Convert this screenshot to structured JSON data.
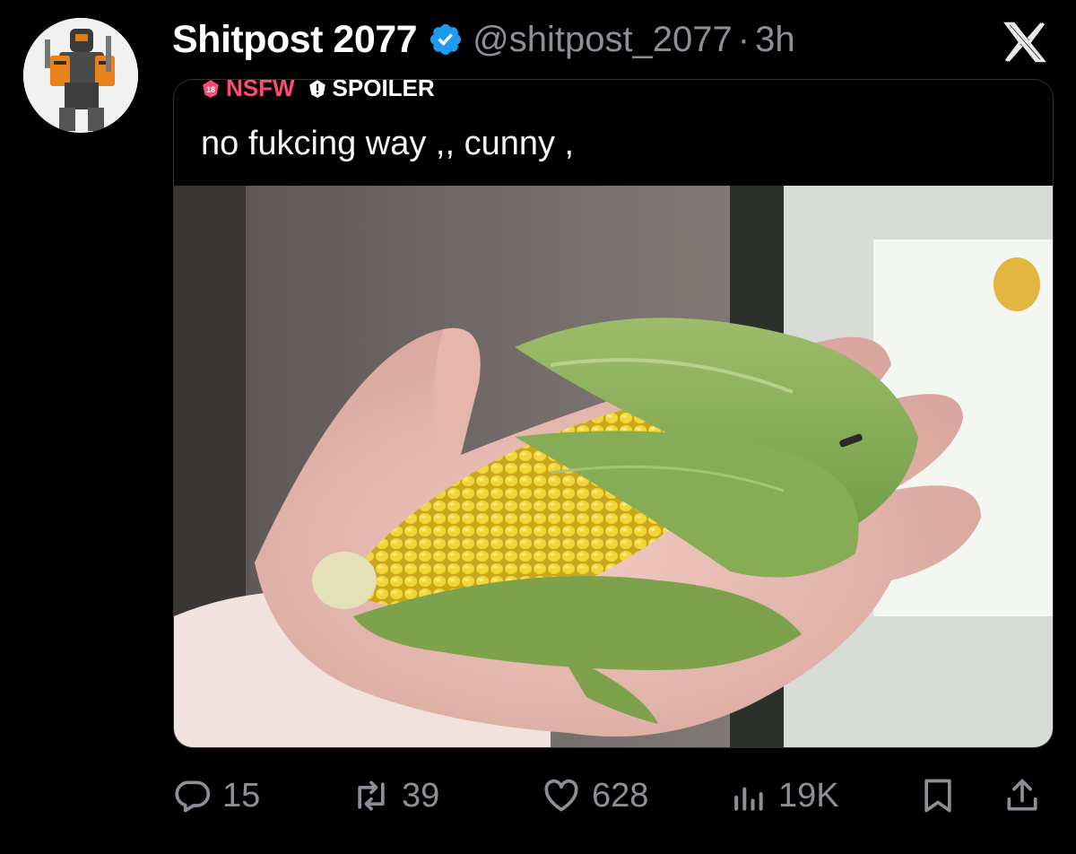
{
  "post": {
    "display_name": "Shitpost 2077",
    "handle": "@shitpost_2077",
    "separator": "·",
    "time": "3h",
    "verified_icon": "verified-badge-icon",
    "brand_icon": "x-logo-icon"
  },
  "media": {
    "tags": [
      {
        "label": "NSFW",
        "color": "#ff4a73",
        "icon": "nsfw-18-icon"
      },
      {
        "label": "SPOILER",
        "color": "#ffffff",
        "icon": "spoiler-icon"
      }
    ],
    "caption": "no fukcing way ,, cunny ,"
  },
  "actions": {
    "replies": "15",
    "reposts": "39",
    "likes": "628",
    "views": "19K"
  },
  "colors": {
    "background": "#000000",
    "muted_text": "#8b9096",
    "verified_blue": "#1d9bf0"
  }
}
